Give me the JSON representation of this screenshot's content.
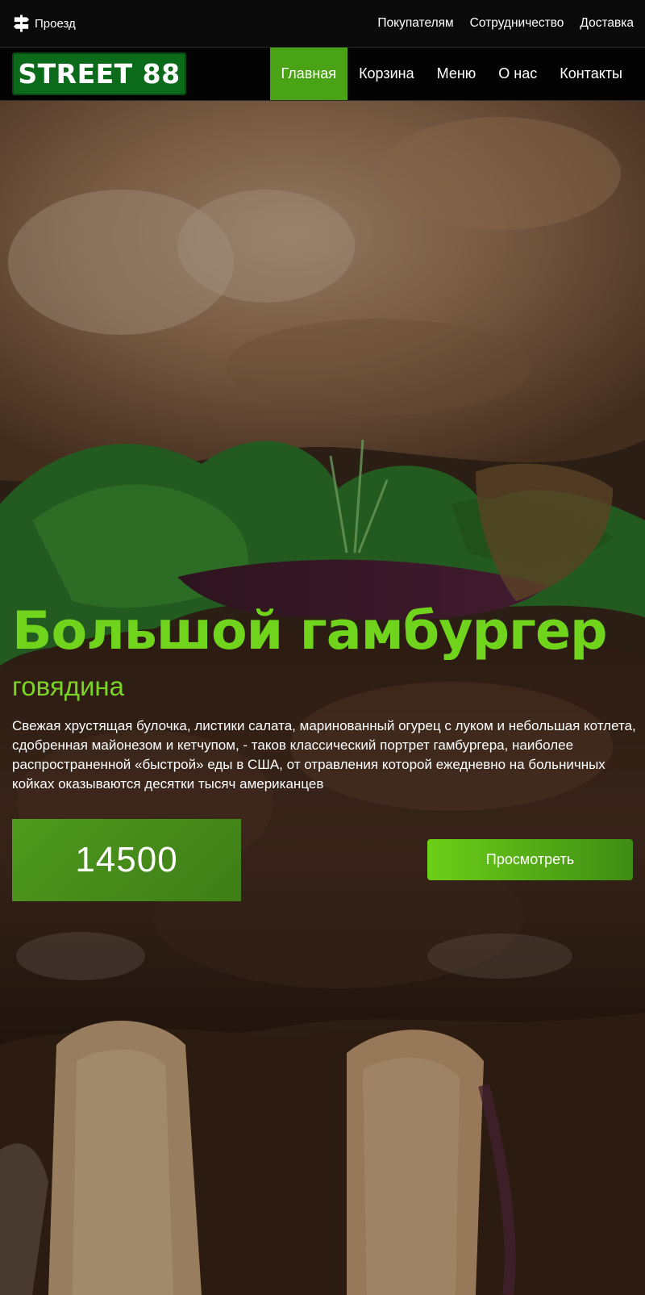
{
  "topbar": {
    "route_icon": "signpost-icon",
    "route_label": "Проезд",
    "links": [
      "Покупателям",
      "Сотрудничество",
      "Доставка"
    ]
  },
  "nav": {
    "logo": "STREET 88",
    "items": [
      {
        "label": "Главная",
        "active": true
      },
      {
        "label": "Корзина",
        "active": false
      },
      {
        "label": "Меню",
        "active": false
      },
      {
        "label": "О нас",
        "active": false
      },
      {
        "label": "Контакты",
        "active": false
      }
    ]
  },
  "hero": {
    "background": "burger-photo",
    "title": "Большой гамбургер",
    "subtitle": "говядина",
    "description": "Свежая хрустящая булочка, листики салата, маринованный огурец с луком и небольшая котлета, сдобренная майонезом и кетчупом, - таков классический портрет гамбургера, наиболее распространенной «быстрой» еды в США, от отравления которой ежедневно на больничных койках оказываются десятки тысяч американцев",
    "price": "14500",
    "view_button": "Просмотреть"
  },
  "colors": {
    "accent": "#6fd41b",
    "nav_active": "#4aa314",
    "logo_bg": "#0c6a1b",
    "price_bg": "#4a8f1c"
  }
}
